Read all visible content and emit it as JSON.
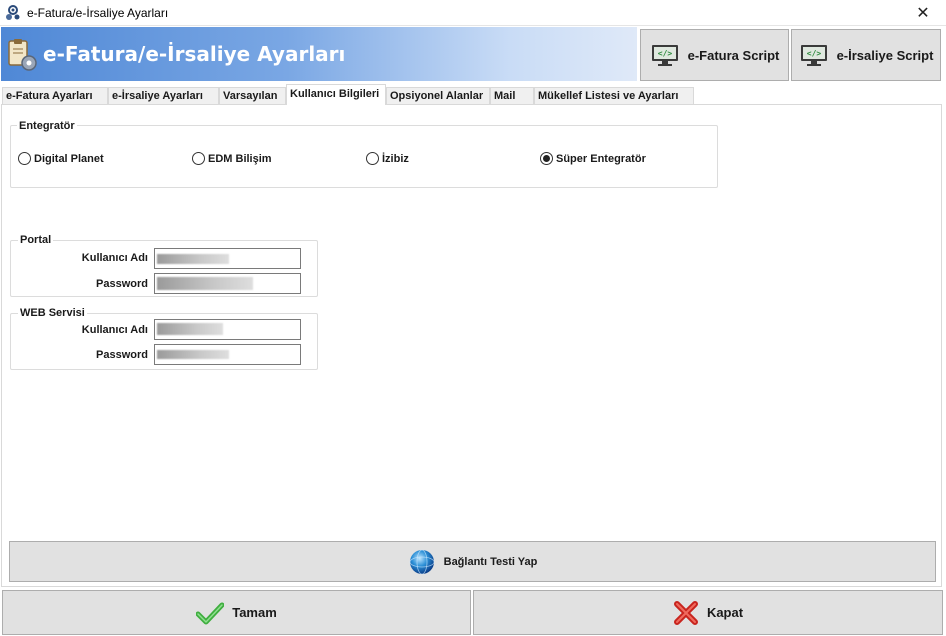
{
  "window": {
    "title": "e-Fatura/e-İrsaliye Ayarları",
    "close_symbol": "✕"
  },
  "header": {
    "title": "e-Fatura/e-İrsaliye Ayarları",
    "efatura_script_label": "e-Fatura Script",
    "eirsaliye_script_label": "e-İrsaliye Script"
  },
  "tabs": [
    {
      "label": "e-Fatura Ayarları",
      "active": false
    },
    {
      "label": "e-İrsaliye Ayarları",
      "active": false
    },
    {
      "label": "Varsayılan",
      "active": false
    },
    {
      "label": "Kullanıcı Bilgileri",
      "active": true
    },
    {
      "label": "Opsiyonel Alanlar",
      "active": false
    },
    {
      "label": "Mail",
      "active": false
    },
    {
      "label": "Mükellef Listesi ve Ayarları",
      "active": false
    }
  ],
  "entegrator": {
    "title": "Entegratör",
    "options": [
      {
        "label": "Digital Planet",
        "checked": false
      },
      {
        "label": "EDM Bilişim",
        "checked": false
      },
      {
        "label": "İzibiz",
        "checked": false
      },
      {
        "label": "Süper Entegratör",
        "checked": true
      }
    ]
  },
  "portal": {
    "title": "Portal",
    "username_label": "Kullanıcı Adı",
    "password_label": "Password"
  },
  "webservice": {
    "title": "WEB Servisi",
    "username_label": "Kullanıcı Adı",
    "password_label": "Password"
  },
  "buttons": {
    "test_connection": "Bağlantı Testi Yap",
    "ok": "Tamam",
    "close": "Kapat"
  },
  "icons": {
    "app": "gear-icon",
    "header": "settings-clipboard-icon",
    "script": "code-monitor-icon",
    "test": "globe-icon",
    "ok": "checkmark-icon",
    "close": "red-x-icon"
  }
}
